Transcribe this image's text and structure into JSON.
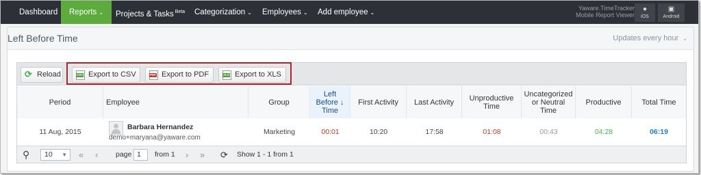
{
  "nav": {
    "items": [
      {
        "label": "Dashboard"
      },
      {
        "label": "Reports",
        "caret": "⌄"
      },
      {
        "label": "Projects & Tasks",
        "badge": "Beta"
      },
      {
        "label": "Categorization",
        "caret": "⌄"
      },
      {
        "label": "Employees",
        "caret": "⌄"
      },
      {
        "label": "Add employee",
        "caret": "⌄"
      }
    ],
    "brand_line1": "Yaware.TimeTracker",
    "brand_line2": "Mobile Report Viewer",
    "ios_label": "iOS",
    "android_label": "Android"
  },
  "panel": {
    "title": "Left Before Time",
    "updates": "Updates every hour"
  },
  "toolbar": {
    "reload": "Reload",
    "export_csv": "Export to CSV",
    "export_pdf": "Export to PDF",
    "export_xls": "Export to XLS",
    "csv_tag": "CSV",
    "pdf_tag": "PDF",
    "xls_tag": "XLS"
  },
  "table": {
    "columns": {
      "period": "Period",
      "employee": "Employee",
      "group": "Group",
      "left_before_time_1": "Left",
      "left_before_time_2": "Before ↓",
      "left_before_time_3": "Time",
      "first_activity": "First Activity",
      "last_activity": "Last Activity",
      "unproductive_1": "Unproductive",
      "unproductive_2": "Time",
      "uncat_1": "Uncategorized",
      "uncat_2": "or Neutral",
      "uncat_3": "Time",
      "productive": "Productive",
      "total_time": "Total Time"
    },
    "rows": [
      {
        "period": "11 Aug, 2015",
        "employee_name": "Barbara Hernandez",
        "employee_email": "demo+maryana@yaware.com",
        "group": "Marketing",
        "left_before_time": "00:01",
        "first_activity": "10:20",
        "last_activity": "17:58",
        "unproductive": "01:08",
        "uncategorized": "00:43",
        "productive": "04:28",
        "total_time": "06:19"
      }
    ]
  },
  "pager": {
    "page_size": "10",
    "page_label": "page",
    "page_value": "1",
    "from_label": "from 1",
    "summary": "Show 1 - 1 from 1"
  },
  "colors": {
    "nav_bg": "#2d3137",
    "nav_active": "#5cab3c",
    "highlight_box": "#a7262b",
    "red_value": "#c0392b",
    "green_value": "#4cae4c",
    "grey_value": "#999999",
    "blue_value": "#1f7fc0"
  }
}
